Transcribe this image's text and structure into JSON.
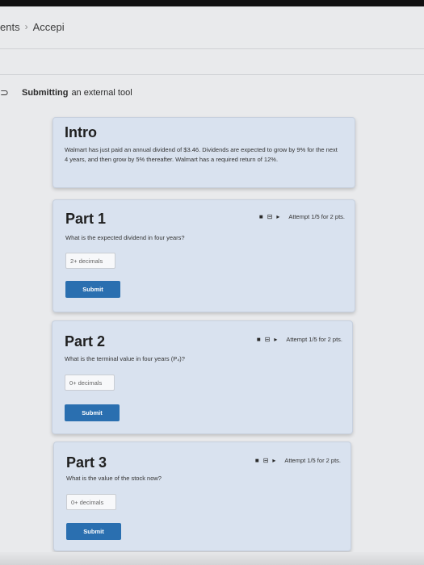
{
  "breadcrumb": {
    "item1": "ents",
    "separator": "›",
    "item2": "Accepi"
  },
  "tool_header": {
    "collapse_icon_glyph": "⊃",
    "bold_text": "Submitting",
    "rest_text": "an external tool"
  },
  "intro": {
    "title": "Intro",
    "body": "Walmart has just paid an annual dividend of $3.46. Dividends are expected to grow by 9% for the next 4 years, and then grow by 5% thereafter. Walmart has a required return of 12%."
  },
  "icons": {
    "tag": "■",
    "calculator": "⊟",
    "flag": "▸"
  },
  "parts": [
    {
      "title": "Part 1",
      "question": "What is the expected dividend in four years?",
      "attempt": "Attempt 1/5 for 2 pts.",
      "placeholder": "2+ decimals",
      "submit_label": "Submit"
    },
    {
      "title": "Part 2",
      "question": "What is the terminal value in four years (P₄)?",
      "attempt": "Attempt 1/5 for 2 pts.",
      "placeholder": "0+ decimals",
      "submit_label": "Submit"
    },
    {
      "title": "Part 3",
      "question": "What is the value of the stock now?",
      "attempt": "Attempt 1/5 for 2 pts.",
      "placeholder": "0+ decimals",
      "submit_label": "Submit"
    }
  ],
  "colors": {
    "page_bg": "#e9eaec",
    "card_bg": "#d9e2ef",
    "submit_bg": "#2a6fb0"
  }
}
